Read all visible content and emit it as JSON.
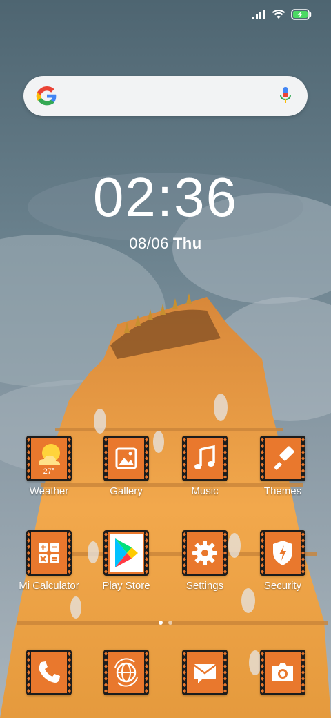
{
  "clock": {
    "time": "02:36",
    "date": "08/06",
    "weekday": "Thu"
  },
  "weather_widget": {
    "temp": "27°"
  },
  "apps": [
    {
      "label": "Weather",
      "icon": "weather-icon"
    },
    {
      "label": "Gallery",
      "icon": "gallery-icon"
    },
    {
      "label": "Music",
      "icon": "music-icon"
    },
    {
      "label": "Themes",
      "icon": "themes-icon"
    },
    {
      "label": "Mi Calculator",
      "icon": "calculator-icon"
    },
    {
      "label": "Play Store",
      "icon": "play-store-icon"
    },
    {
      "label": "Settings",
      "icon": "settings-icon"
    },
    {
      "label": "Security",
      "icon": "security-icon"
    }
  ],
  "dock": [
    {
      "icon": "phone-icon"
    },
    {
      "icon": "browser-icon"
    },
    {
      "icon": "messaging-icon"
    },
    {
      "icon": "camera-icon"
    }
  ],
  "colors": {
    "icon_orange": "#e9782d",
    "pattern_dark": "#1c1c1c",
    "sky": "#5f7783",
    "temple": "#f0a84a"
  },
  "status": {
    "battery": "charging"
  }
}
